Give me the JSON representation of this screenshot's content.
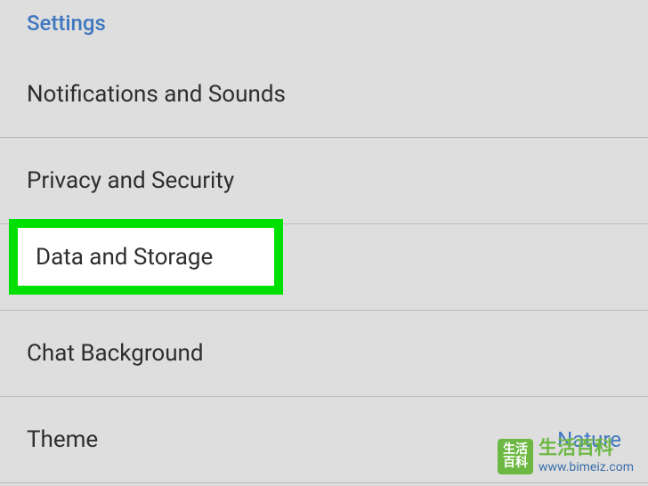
{
  "section_header": "Settings",
  "items": [
    {
      "label": "Notifications and Sounds",
      "value": ""
    },
    {
      "label": "Privacy and Security",
      "value": ""
    },
    {
      "label": "Data and Storage",
      "value": ""
    },
    {
      "label": "Chat Background",
      "value": ""
    },
    {
      "label": "Theme",
      "value": "Nature"
    }
  ],
  "highlighted_item_label": "Data and Storage",
  "watermark": {
    "logo_line1": "生活",
    "logo_line2": "百科",
    "cn": "生活百科",
    "url": "www.bimeiz.com"
  }
}
